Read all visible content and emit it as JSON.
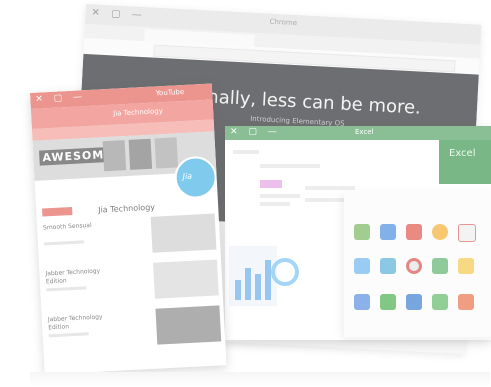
{
  "back_window": {
    "title": "Chrome",
    "controls": "✕ ▢ —",
    "headline": "Finally, less can be more.",
    "subhead": "Introducing Elementary OS"
  },
  "video_app": {
    "title": "YouTube",
    "controls": "✕ ▢ —",
    "channel_header": "Jia Technology",
    "banner_text": "AWESOME",
    "avatar_text": "Jia",
    "channel_name": "Jia Technology",
    "videos": [
      {
        "title": "Smooth Sensual"
      },
      {
        "title": "Jabber Technology Edition"
      },
      {
        "title": "Jabber Technology Edition"
      }
    ]
  },
  "office_window": {
    "title": "Excel",
    "controls": "✕ ▢ —",
    "brand": "Excel"
  },
  "colors": {
    "red": "#e4675f",
    "green": "#58a468",
    "dark_hero": "#2e3034",
    "avatar_blue": "#4ab4e6"
  },
  "app_icons": [
    "evernote-icon",
    "play-icon",
    "youtube-icon",
    "chrome-icon",
    "gmail-icon",
    "twitter-icon",
    "grid-icon",
    "chrome-icon",
    "maps-icon",
    "drive-icon",
    "docs-icon",
    "sheets-icon",
    "slides-icon",
    "files-icon",
    "photos-icon"
  ]
}
